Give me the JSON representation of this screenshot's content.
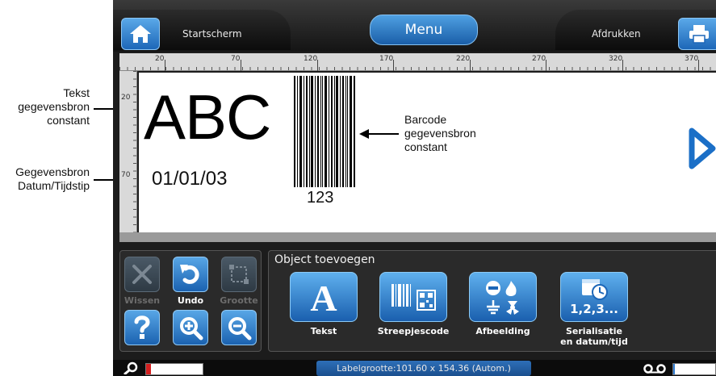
{
  "callouts": {
    "text_source": [
      "Tekst",
      "gegevensbron",
      "constant"
    ],
    "date_source": [
      "Gegevensbron",
      "Datum/Tijdstip"
    ],
    "barcode_source": [
      "Barcode",
      "gegevensbron",
      "constant"
    ]
  },
  "topbar": {
    "home_label": "Startscherm",
    "menu_label": "Menu",
    "print_label": "Afdrukken"
  },
  "ruler": {
    "horizontal_ticks": [
      "20",
      "70",
      "120",
      "170",
      "220",
      "270",
      "320",
      "370"
    ],
    "vertical_ticks": [
      "20",
      "70"
    ]
  },
  "label": {
    "text_object": "ABC",
    "date_object": "01/01/03",
    "barcode_value": "123"
  },
  "edit_tools": {
    "delete_label": "Wissen",
    "undo_label": "Undo",
    "size_label": "Grootte"
  },
  "add_object": {
    "title": "Object toevoegen",
    "text_label": "Tekst",
    "barcode_label": "Streepjescode",
    "image_label": "Afbeelding",
    "serial_label_1": "Serialisatie",
    "serial_label_2": "en datum/tijd",
    "serial_icon_text": "1,2,3..."
  },
  "status": {
    "label_size": "Labelgrootte:101.60 x 154.36 (Autom.)",
    "ribbon_level": 0.08,
    "tape_level": 0.02
  },
  "colors": {
    "accent": "#1d67b8",
    "screen_bg": "#1c1c1c",
    "arrow_blue": "#1b6fc7",
    "meter_red": "#d41f1f"
  }
}
